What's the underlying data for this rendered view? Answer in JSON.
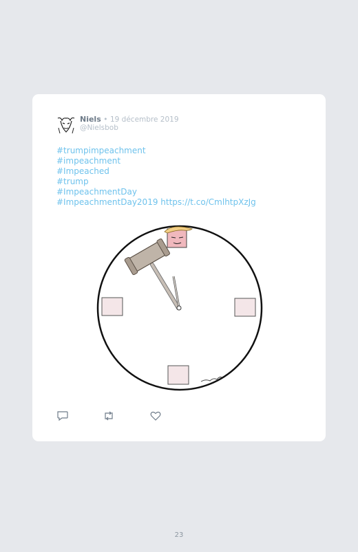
{
  "tweet": {
    "author_name": "Niels",
    "separator": "•",
    "date": "19 décembre 2019",
    "handle": "@Nielsbob",
    "lines": [
      "#trumpimpeachment",
      "#impeachment",
      "#Impeached",
      "#trump",
      "#ImpeachmentDay",
      "#ImpeachmentDay2019 https://t.co/CmlhtpXzJg"
    ],
    "actions": [
      "reply-icon",
      "retweet-icon",
      "like-icon"
    ]
  },
  "page": {
    "number": "23"
  },
  "colors": {
    "background": "#e6e8ec",
    "card": "#ffffff",
    "link": "#6ec2ec",
    "muted": "#b5bfc9"
  }
}
